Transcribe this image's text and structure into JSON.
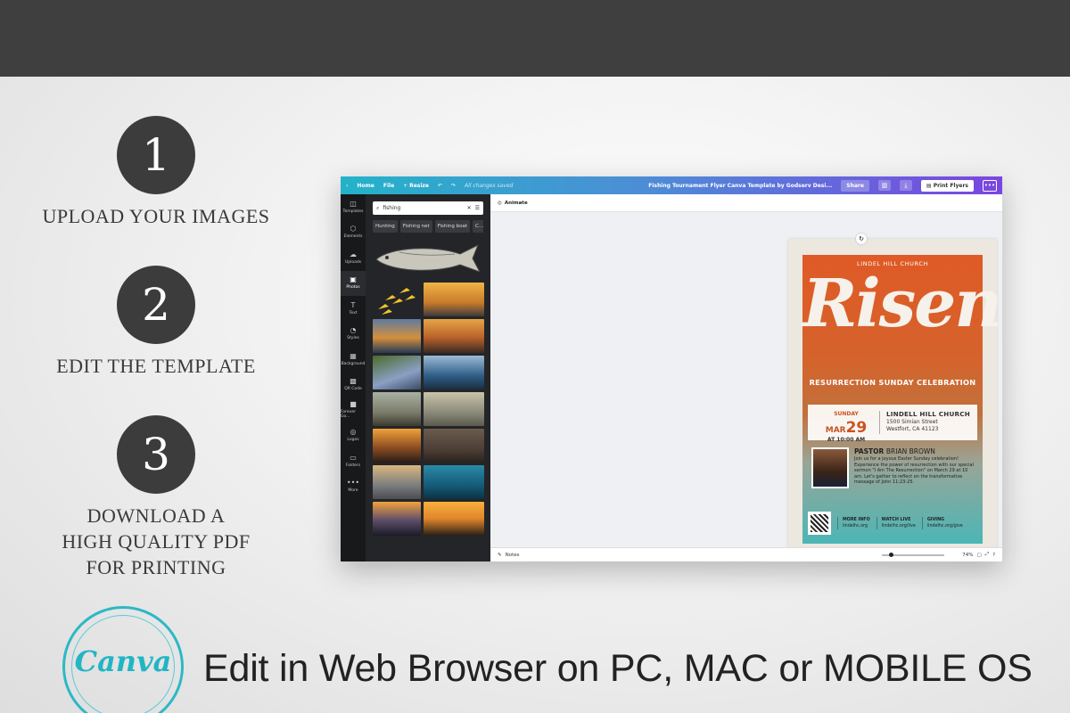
{
  "steps": [
    {
      "number": "1",
      "label": "UPLOAD YOUR IMAGES"
    },
    {
      "number": "2",
      "label": "EDIT THE TEMPLATE"
    },
    {
      "number": "3",
      "label_lines": [
        "DOWNLOAD A",
        "HIGH QUALITY PDF",
        "FOR PRINTING"
      ]
    }
  ],
  "brand": {
    "logo_text": "Canva",
    "accent": "#2cb8c6"
  },
  "tagline": "Edit in Web Browser on PC, MAC or MOBILE OS",
  "editor": {
    "topbar": {
      "home": "Home",
      "file": "File",
      "resize": "Resize",
      "saved": "All changes saved",
      "doc_title": "Fishing Tournament Flyer Canva Template by Godserv Desi...",
      "share": "Share",
      "print": "Print Flyers"
    },
    "sidebar": [
      {
        "label": "Templates",
        "icon": "templates-icon"
      },
      {
        "label": "Elements",
        "icon": "elements-icon"
      },
      {
        "label": "Uploads",
        "icon": "uploads-icon"
      },
      {
        "label": "Photos",
        "icon": "photos-icon"
      },
      {
        "label": "Text",
        "icon": "text-icon"
      },
      {
        "label": "Styles",
        "icon": "styles-icon"
      },
      {
        "label": "Background",
        "icon": "background-icon"
      },
      {
        "label": "QR Code",
        "icon": "qr-code-icon"
      },
      {
        "label": "Forever Go...",
        "icon": "folder-app-icon"
      },
      {
        "label": "Logos",
        "icon": "logos-icon"
      },
      {
        "label": "Folders",
        "icon": "folders-icon"
      },
      {
        "label": "More",
        "icon": "more-icon"
      }
    ],
    "panel": {
      "search_value": "fishing",
      "chips": [
        "Hunting",
        "Fishing net",
        "Fishing boat",
        "C..."
      ]
    },
    "animate": "Animate",
    "notes": "Notes",
    "zoom": "74%"
  },
  "flyer": {
    "church_top": "LINDEL HILL CHURCH",
    "headline": "Risen",
    "subtitle": "RESURRECTION SUNDAY CELEBRATION",
    "date_day": "SUNDAY",
    "date_month": "MAR",
    "date_num": "29",
    "date_time": "AT 10:00 AM",
    "church_name": "LINDELL HILL CHURCH",
    "address1": "1500 Simian Street",
    "address2": "Westfort, CA 41123",
    "pastor_label": "PASTOR",
    "pastor_name": "BRIAN BROWN",
    "pastor_bio": "Join us for a joyous Easter Sunday celebration! Experience the power of resurrection with our special sermon \"I Am The Resurrection\" on March 29 at 10 am. Let's gather to reflect on the transformative message of John 11:23-25.",
    "footer": [
      {
        "title": "MORE INFO",
        "value": "lindelhc.org"
      },
      {
        "title": "WATCH LIVE",
        "value": "lindelhc.org/live"
      },
      {
        "title": "GIVING",
        "value": "lindelhc.org/give"
      }
    ]
  }
}
